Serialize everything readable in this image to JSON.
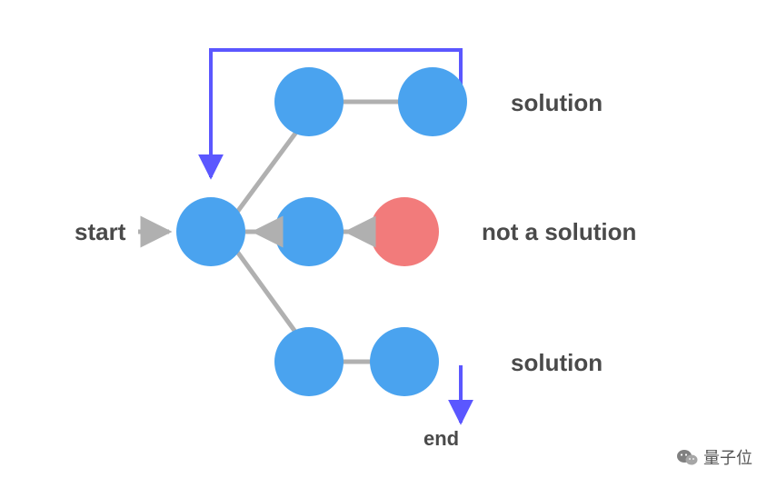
{
  "labels": {
    "start": "start",
    "solution_top": "solution",
    "not_solution": "not a solution",
    "solution_bottom": "solution",
    "end": "end"
  },
  "watermark": "量子位",
  "colors": {
    "node_blue": "#4aa3ef",
    "node_red": "#f27b7b",
    "edge_gray": "#b0b0b0",
    "flow_purple": "#5b57ff",
    "text": "#4a4a4a"
  },
  "chart_data": {
    "type": "diagram",
    "description": "Backtracking search tree showing a start node branching to three paths; top and bottom reach blue solution nodes (solution), middle reaches a red failure node (not a solution) and backtracks. Purple arrows show control flow returning from top solution to start, and from bottom solution to end.",
    "nodes": [
      {
        "id": "start",
        "label": "start",
        "color": "blue",
        "x": 0,
        "y": 1
      },
      {
        "id": "a1",
        "color": "blue",
        "x": 1,
        "y": 0
      },
      {
        "id": "a2",
        "color": "blue",
        "x": 2,
        "y": 0,
        "label": "solution"
      },
      {
        "id": "b1",
        "color": "blue",
        "x": 1,
        "y": 1
      },
      {
        "id": "b2",
        "color": "red",
        "x": 2,
        "y": 1,
        "label": "not a solution"
      },
      {
        "id": "c1",
        "color": "blue",
        "x": 1,
        "y": 2
      },
      {
        "id": "c2",
        "color": "blue",
        "x": 2,
        "y": 2,
        "label": "solution"
      }
    ],
    "edges": [
      {
        "from": "start",
        "to": "a1"
      },
      {
        "from": "a1",
        "to": "a2"
      },
      {
        "from": "start",
        "to": "b1"
      },
      {
        "from": "b1",
        "to": "b2"
      },
      {
        "from": "start",
        "to": "c1"
      },
      {
        "from": "c1",
        "to": "c2"
      }
    ],
    "backtrack_arrows": [
      {
        "from": "b2",
        "to": "b1"
      },
      {
        "from": "b1",
        "to": "start"
      }
    ],
    "flow_arrows": [
      {
        "from": "a2",
        "to": "start",
        "path": "up-left-down"
      },
      {
        "from": "c2",
        "to": "end",
        "path": "down"
      }
    ]
  }
}
